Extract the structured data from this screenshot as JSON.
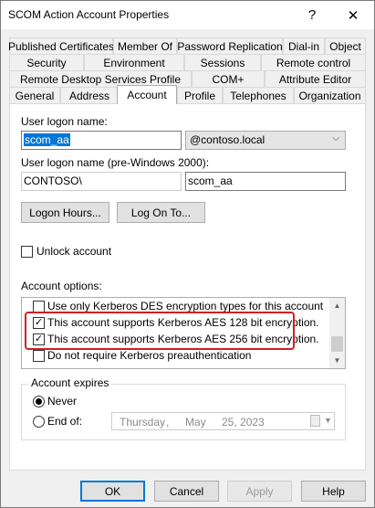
{
  "window": {
    "title": "SCOM Action Account Properties",
    "help_glyph": "?",
    "close_glyph": "✕"
  },
  "tabs": {
    "row1": [
      "Published Certificates",
      "Member Of",
      "Password Replication",
      "Dial-in",
      "Object"
    ],
    "row2": [
      "Security",
      "Environment",
      "Sessions",
      "Remote control"
    ],
    "row3": [
      "Remote Desktop Services Profile",
      "COM+",
      "Attribute Editor"
    ],
    "row4": [
      "General",
      "Address",
      "Account",
      "Profile",
      "Telephones",
      "Organization"
    ],
    "active": "Account"
  },
  "account": {
    "logon_name_label": "User logon name:",
    "logon_name_value": "scom_aa",
    "domain_value": "@contoso.local",
    "pre2000_label": "User logon name (pre-Windows 2000):",
    "pre2000_domain": "CONTOSO\\",
    "pre2000_user": "scom_aa",
    "logon_hours_button": "Logon Hours...",
    "log_on_to_button": "Log On To...",
    "unlock_label": "Unlock account",
    "unlock_checked": false,
    "options_label": "Account options:",
    "options": [
      {
        "label": "Use only Kerberos DES encryption types for this account",
        "checked": false
      },
      {
        "label": "This account supports Kerberos AES 128 bit encryption.",
        "checked": true
      },
      {
        "label": "This account supports Kerberos AES 256 bit encryption.",
        "checked": true
      },
      {
        "label": "Do not require Kerberos preauthentication",
        "checked": false
      }
    ],
    "expires": {
      "title": "Account expires",
      "never_label": "Never",
      "never_selected": true,
      "endof_label": "End of:",
      "endof_selected": false,
      "date_weekday": "Thursday",
      "date_sep1": ",",
      "date_month": "May",
      "date_day_year": "25, 2023"
    }
  },
  "footer": {
    "ok": "OK",
    "cancel": "Cancel",
    "apply": "Apply",
    "help": "Help"
  },
  "colors": {
    "selection": "#0078d7",
    "highlight_border": "#d02020"
  }
}
